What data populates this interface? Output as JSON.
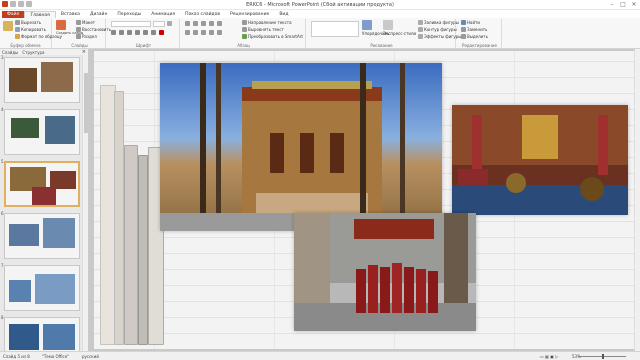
{
  "window": {
    "title": "ERKC6 - Microsoft PowerPoint (Сбой активации продукта)"
  },
  "tabs": [
    {
      "label": "Файл",
      "active": false,
      "file": true
    },
    {
      "label": "Главная",
      "active": true
    },
    {
      "label": "Вставка"
    },
    {
      "label": "Дизайн"
    },
    {
      "label": "Переходы"
    },
    {
      "label": "Анимация"
    },
    {
      "label": "Показ слайдов"
    },
    {
      "label": "Рецензирование"
    },
    {
      "label": "Вид"
    }
  ],
  "ribbon": {
    "clipboard": {
      "paste": "Вставить",
      "cut": "Вырезать",
      "copy": "Копировать",
      "format_painter": "Формат по образцу",
      "label": "Буфер обмена"
    },
    "slides": {
      "new_slide": "Создать слайд",
      "layout": "Макет",
      "reset": "Восстановить",
      "section": "Раздел",
      "label": "Слайды"
    },
    "font": {
      "label": "Шрифт"
    },
    "paragraph": {
      "text_direction": "Направление текста",
      "align_text": "Выровнять текст",
      "smartart": "Преобразовать в SmartArt",
      "label": "Абзац"
    },
    "drawing": {
      "arrange": "Упорядочить",
      "quick_styles": "Экспресс-стили",
      "shape_fill": "Заливка фигуры",
      "shape_outline": "Контур фигуры",
      "shape_effects": "Эффекты фигуры",
      "label": "Рисование"
    },
    "editing": {
      "find": "Найти",
      "replace": "Заменить",
      "select": "Выделить",
      "label": "Редактирование"
    }
  },
  "panel": {
    "tab_slides": "Слайды",
    "tab_outline": "Структура",
    "close": "×"
  },
  "thumbnails": [
    {
      "num": "3",
      "selected": false
    },
    {
      "num": "4",
      "selected": false
    },
    {
      "num": "5",
      "selected": true
    },
    {
      "num": "6",
      "selected": false
    },
    {
      "num": "7",
      "selected": false
    },
    {
      "num": "8",
      "selected": false
    }
  ],
  "status": {
    "slide": "Слайд 5 из 8",
    "theme": "\"Тема Office\"",
    "language": "русский",
    "zoom": "53%"
  }
}
